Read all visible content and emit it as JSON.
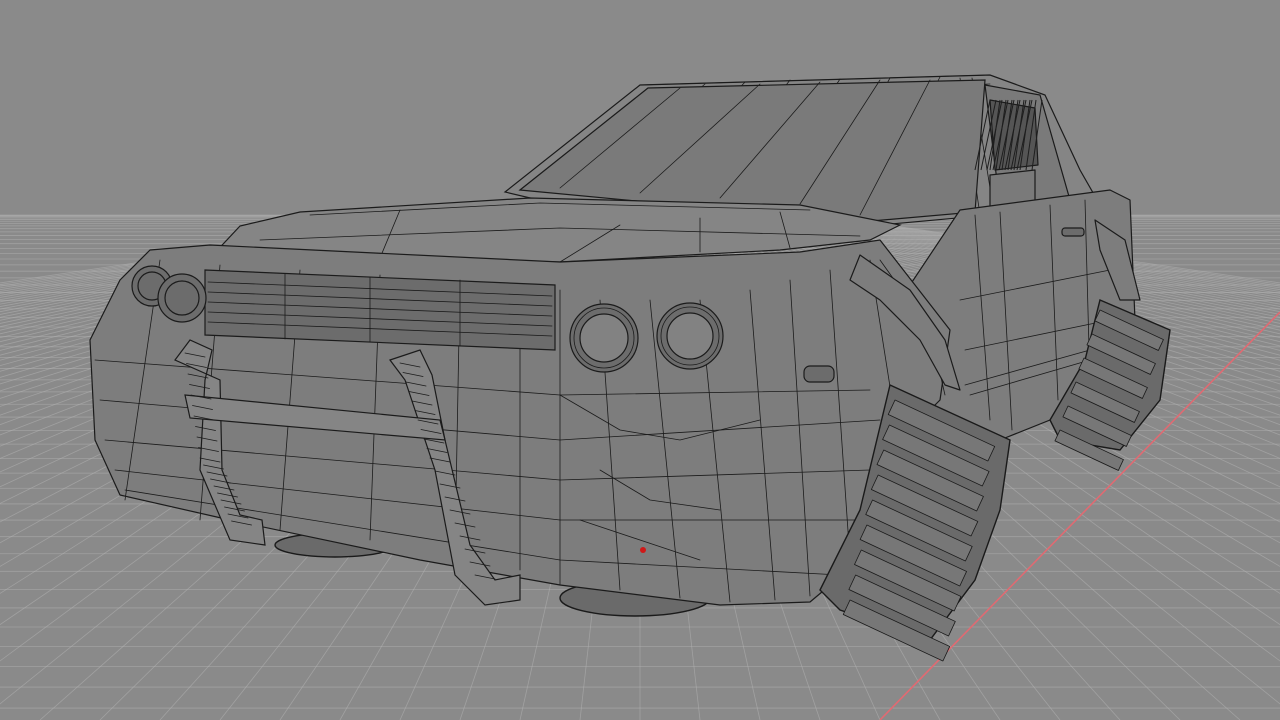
{
  "viewport": {
    "mode": "wireframe-3d-viewport",
    "background_color": "#8a8a8a",
    "grid_color": "#b4b4b4",
    "axis_x_color": "#e06a72",
    "wire_color": "#1b1b1b",
    "origin_marker_color": "#d01818"
  },
  "model": {
    "icon": "car-wireframe-icon"
  }
}
